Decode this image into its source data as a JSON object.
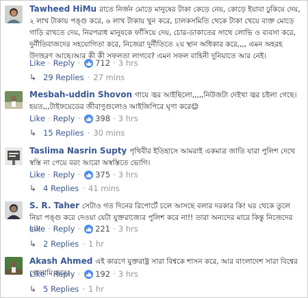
{
  "actions": {
    "like": "Like",
    "reply": "Reply",
    "sep": "·"
  },
  "comments": [
    {
      "author": "Tawheed HiMu",
      "text": "রাতে নির্জন মোড়ে মানুষের টাকা কেড়ে নেয়, কোড়ে ইয়াবা ঢুকিয়ে দেয়, ২ লাখ টাকায় পঙ্গু করে, ৬ লাখ টাকায় খুন করে, চালকসমিতি থেকে টাকা খেয়ে ব্যক্ত মোড়ে গাড়ি রাখতে দেয়, নিরপরাধ মানুষকে ফাঁসিয়ে দেয়, চোর-ডাকাতের সাথে লোভি ও ব্যবসা করে, দুর্নীতিবাজদের সহযোগিতা করে, নিজেরা দুর্নীতিতে ২য় স্থান অধিকার করে,,,, এমন অহরহ উদাহরণ আছে।আর কী কী সফলতা লাগবে? এমন সফল বাহিনী দুনিয়াতে আর নেই।",
      "likes": "712",
      "time": "3 hrs",
      "replies": "29 Replies",
      "reply_time": "27 mins"
    },
    {
      "author": "Mesbah-uddin Shovon",
      "text": "গায়ে জ্বর আইছিলো,,,,,নিউজটা দেইখা জ্বর চইলা গেছে। হয়ত,,,টাইফয়েডের জীবাণুগুলোও আইজিপিরে ঘৃণা করে😊",
      "likes": "398",
      "time": "3 hrs",
      "replies": "15 Replies",
      "reply_time": "30 mins"
    },
    {
      "author": "Taslima Nasrin Supty",
      "text": "পৃথিবীর ইতিহাসে আমরাই একমাত্র জাতি যারা পুলিশ দেখে স্বস্তি না পেয়ে বরং আরো অস্বস্তিতে ভোগি।",
      "likes": "375",
      "time": "3 hrs",
      "replies": "4 Replies",
      "reply_time": "41 mins"
    },
    {
      "author": "S. R. Taher",
      "text": "সেটাও গত দিনের রিপোর্টে চলে আসছে বলার দরকার কি! ঘর থেকে তুলে নিয়া পঙ্গু করে দেওয়া যেটা যুক্তরাজ্যের পুলিশ করে না!! তারা অন্যদের মারে কিন্তু নিজেদের নয়!",
      "likes": "221",
      "time": "3 hrs",
      "replies": "2 Replies",
      "reply_time": "1 hr"
    },
    {
      "author": "Akash Ahmed",
      "text": "এই কারণে যুক্তরাষ্ট্র সারা বিশ্বকে শাসন করে, আর বাংলাদেশ সারা বিশ্বের গোলামি করে।",
      "likes": "192",
      "time": "3 hrs",
      "replies": "5 Replies",
      "reply_time": "1 hr"
    }
  ]
}
